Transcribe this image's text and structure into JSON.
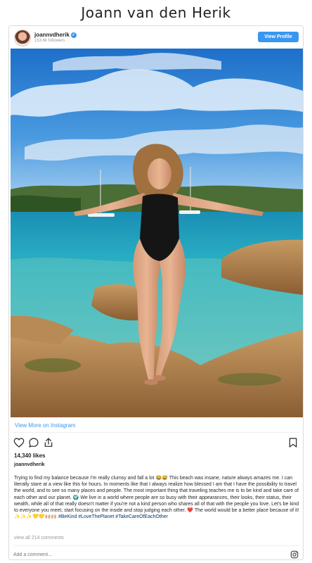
{
  "page": {
    "title": "Joann van den Herik"
  },
  "post": {
    "username": "joannvdherik",
    "verified_mark": "✓",
    "followers": "153.6k followers",
    "view_profile_label": "View Profile",
    "view_more_label": "View More on Instagram",
    "likes": "14,340 likes",
    "caption_username": "joannvdherik",
    "caption_text": "Trying to find my balance because I'm really clumsy and fall a lot 😂😅 This beach was insane, nature always amazes me. I can literally stare at a view like this for hours. In moments like that I always realize how blessed I am that I have the possibility to travel the world, and to see so many places and people. The most important thing that traveling teaches me is to be kind and take care of each other and our planet. 🌍 We live in a world where people are so busy with their appearances, their looks, their status, their wealth, while all of that really doesn't matter if you're not a kind person who shares all of that with the people you love. Let's be kind to everyone you meet, start focusing on the inside and stop judging each other. ❤️ The world would be a better place because of it! ✨✨✨💛💛🙌🏼🙌🏼",
    "hashtags": "#BeKind #LoveThePlanet #TakeCareOfEachOther",
    "comments_link": "view all 214 comments",
    "comment_placeholder": "Add a comment..."
  },
  "icons": {
    "like": "heart-outline",
    "comment": "speech-bubble",
    "share": "share-arrow",
    "save": "bookmark",
    "instagram": "instagram-glyph"
  },
  "colors": {
    "accent": "#3897f0",
    "hashtag": "#003569",
    "muted": "#999999",
    "text": "#262626"
  }
}
